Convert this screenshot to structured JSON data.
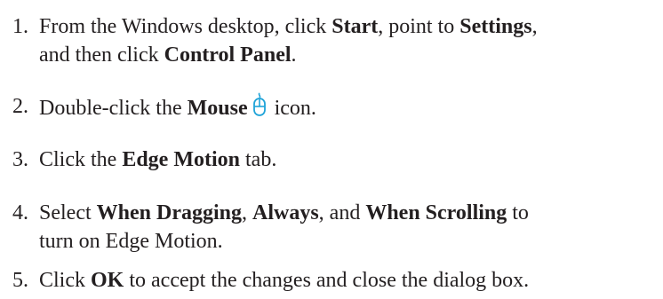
{
  "steps": [
    {
      "number": "1.",
      "line1": {
        "t1": "From the Windows desktop, click ",
        "b1": "Start",
        "t2": ", point to ",
        "b2": "Settings",
        "t3": ","
      },
      "line2": {
        "t1": "and then click ",
        "b1": "Control Panel",
        "t2": "."
      }
    },
    {
      "number": "2.",
      "t1": "Double-click the ",
      "b1": "Mouse",
      "t2": " icon.",
      "icon": "mouse-icon",
      "icon_color": "#1fa3d8"
    },
    {
      "number": "3.",
      "t1": "Click the ",
      "b1": "Edge Motion",
      "t2": " tab."
    },
    {
      "number": "4.",
      "line1": {
        "t1": "Select ",
        "b1": "When Dragging",
        "t2": ", ",
        "b2": "Always",
        "t3": ", and ",
        "b3": "When Scrolling",
        "t4": " to"
      },
      "line2": {
        "t1": "turn on Edge Motion."
      }
    },
    {
      "number": "5.",
      "t1": "Click ",
      "b1": "OK",
      "t2": " to accept the changes and close the dialog box."
    }
  ]
}
